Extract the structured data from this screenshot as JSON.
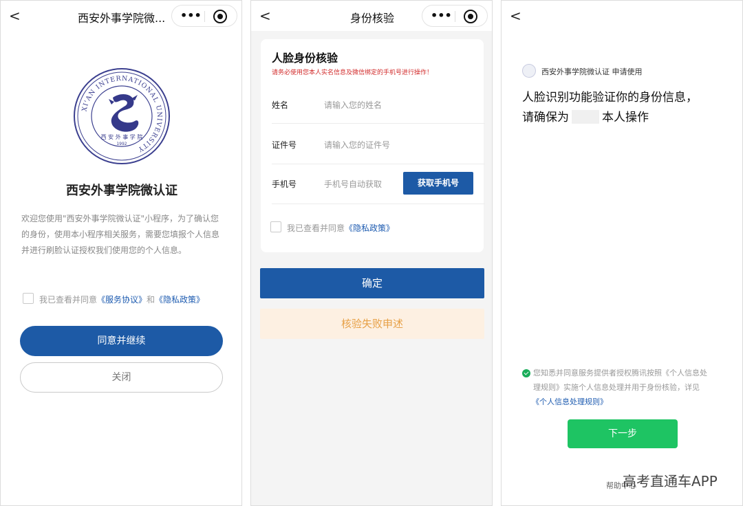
{
  "screen1": {
    "nav_back": "<",
    "nav_title": "西安外事学院微...",
    "capsule_more": "•••",
    "logo_text": "XI'AN INTERNATIONAL UNIVERSITY",
    "logo_chinese": "西 安 外 事 学 院",
    "logo_year": "1992",
    "title": "西安外事学院微认证",
    "desc": "欢迎您使用\"西安外事学院微认证\"小程序，为了确认您的身份，使用本小程序相关服务，需要您填报个人信息并进行刷脸认证授权我们使用您的个人信息。",
    "agree_prefix": "我已查看并同意",
    "agree_link1": "《服务协议》",
    "agree_mid": "和",
    "agree_link2": "《隐私政策》",
    "btn_agree": "同意并继续",
    "btn_close": "关闭"
  },
  "screen2": {
    "nav_back": "<",
    "nav_title": "身份核验",
    "capsule_more": "•••",
    "heading": "人脸身份核验",
    "warning": "请务必使用您本人实名信息及微信绑定的手机号进行操作！",
    "rows": [
      {
        "label": "姓名",
        "placeholder": "请输入您的姓名"
      },
      {
        "label": "证件号",
        "placeholder": "请输入您的证件号"
      },
      {
        "label": "手机号",
        "placeholder": "手机号自动获取"
      }
    ],
    "get_phone": "获取手机号",
    "agree_prefix": "我已查看并同意",
    "agree_link": "《隐私政策》",
    "btn_confirm": "确定",
    "btn_fail": "核验失败申述"
  },
  "screen3": {
    "nav_back": "<",
    "app_line": "西安外事学院微认证 申请使用",
    "headline1": "人脸识别功能验证你的身份信息，",
    "headline2_pre": "请确保为",
    "headline2_post": "本人操作",
    "consent_line1": "您知悉并同意服务提供者授权腾讯按照《个人信息处",
    "consent_line2": "理规则》实施个人信息处理并用于身份核验，详见",
    "consent_link": "《个人信息处理规则》",
    "btn_next": "下一步",
    "help": "帮助中心"
  },
  "watermark": "高考直通车APP",
  "colors": {
    "primary": "#1d5aa6",
    "link": "#1d5bb0",
    "green": "#1ec463",
    "warn": "#d22b2b",
    "fail_bg": "#fdf0e2",
    "fail_text": "#e7a046"
  }
}
